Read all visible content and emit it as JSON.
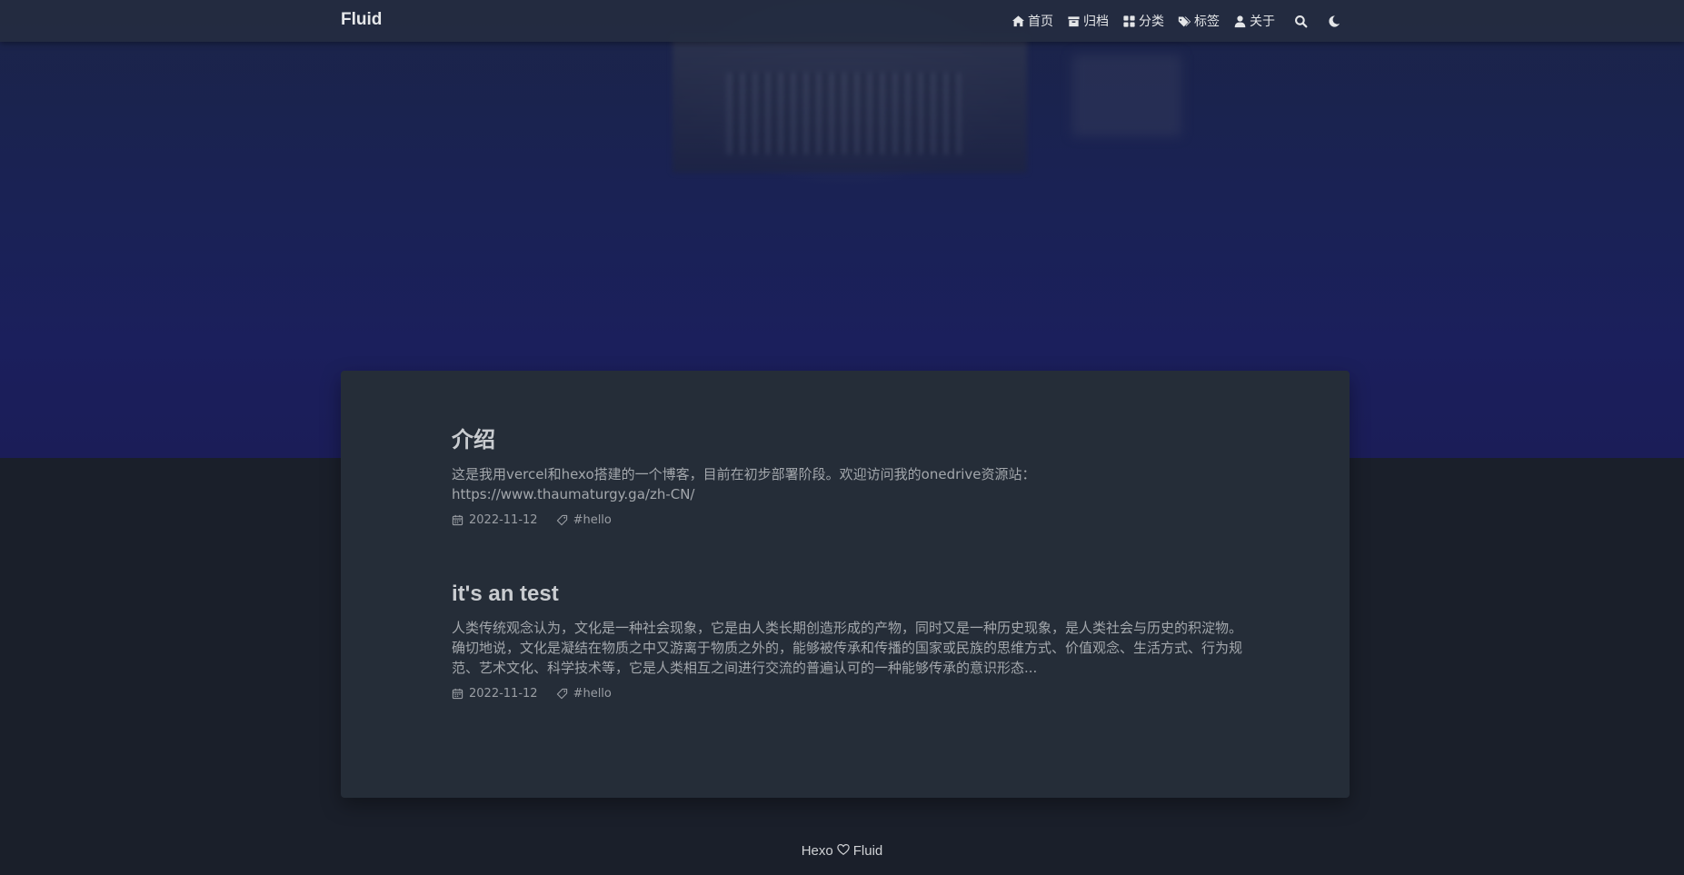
{
  "navbar": {
    "brand": "Fluid",
    "items": [
      {
        "label": "首页",
        "icon": "home-icon"
      },
      {
        "label": "归档",
        "icon": "archive-icon"
      },
      {
        "label": "分类",
        "icon": "category-icon"
      },
      {
        "label": "标签",
        "icon": "tags-icon"
      },
      {
        "label": "关于",
        "icon": "user-icon"
      }
    ],
    "search_icon": "search-icon",
    "theme_icon": "moon-icon"
  },
  "posts": [
    {
      "title": "介绍",
      "excerpt": "这是我用vercel和hexo搭建的一个博客，目前在初步部署阶段。欢迎访问我的onedrive资源站：https://www.thaumaturgy.ga/zh-CN/",
      "date": "2022-11-12",
      "tag": "#hello"
    },
    {
      "title": "it's an test",
      "excerpt": "人类传统观念认为，文化是一种社会现象，它是由人类长期创造形成的产物，同时又是一种历史现象，是人类社会与历史的积淀物。确切地说，文化是凝结在物质之中又游离于物质之外的，能够被传承和传播的国家或民族的思维方式、价值观念、生活方式、行为规范、艺术文化、科学技术等，它是人类相互之间进行交流的普遍认可的一种能够传承的意识形态...",
      "date": "2022-11-12",
      "tag": "#hello"
    }
  ],
  "footer": {
    "left": "Hexo",
    "right": "Fluid",
    "icon": "heart-icon"
  },
  "colors": {
    "navbar_bg": "#242c40",
    "hero_bg": "#1a2255",
    "page_bg": "#1a1f2a",
    "card_bg": "#252d38"
  }
}
